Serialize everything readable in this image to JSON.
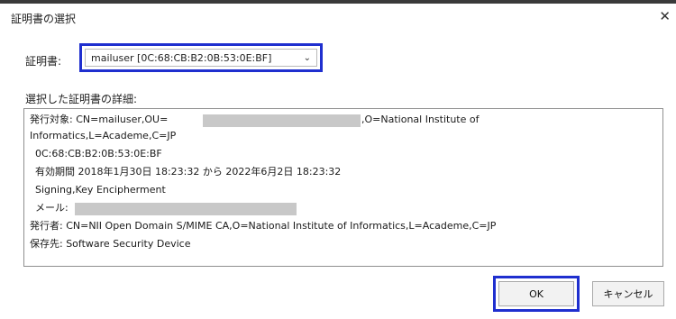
{
  "window": {
    "title": "証明書の選択",
    "close_glyph": "✕"
  },
  "certificate": {
    "label": "証明書:",
    "selected_value": "mailuser [0C:68:CB:B2:0B:53:0E:BF]",
    "chevron": "⌄"
  },
  "details": {
    "label": "選択した証明書の詳細:",
    "issued_to_prefix": "発行対象: CN=mailuser,OU=",
    "issued_to_suffix": ",O=National Institute of",
    "issued_to_line2": "Informatics,L=Academe,C=JP",
    "serial": "0C:68:CB:B2:0B:53:0E:BF",
    "validity": "有効期間 2018年1月30日 18:23:32 から 2022年6月2日 18:23:32",
    "usage": "Signing,Key Encipherment",
    "mail_label": "メール:",
    "issuer": "発行者: CN=NII Open Domain S/MIME CA,O=National Institute of Informatics,L=Academe,C=JP",
    "storage": "保存先: Software Security Device"
  },
  "buttons": {
    "ok": "OK",
    "cancel": "キャンセル"
  }
}
